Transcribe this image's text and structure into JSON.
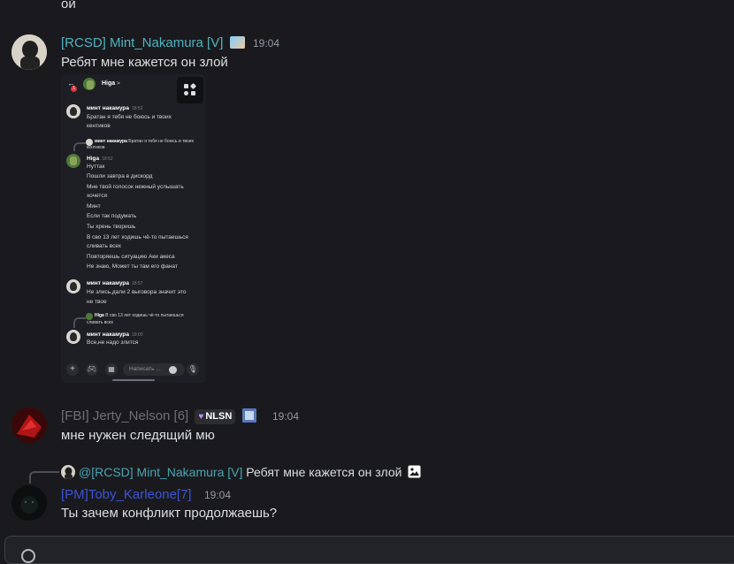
{
  "top_fragment": "ой",
  "messages": [
    {
      "username": "[RCSD] Mint_Nakamura [V]",
      "username_color": "#4fb3c0",
      "time": "19:04",
      "text": "Ребят мне кажется он злой",
      "attachment": {
        "header_name": "Higa",
        "header_chevron": ">",
        "badge_count": "1",
        "chat": {
          "m1_name": "минт накамура",
          "m1_time": "18:52",
          "m1_lines": [
            "Братан я тебя не боюсь и твоих",
            "кентиков"
          ],
          "reply1_name": "минт накамура",
          "reply1_text": "Братан я тебя не боюсь и твоих",
          "reply1_text2": "кентиков",
          "m2_name": "Higa",
          "m2_time": "18:52",
          "m2_lines": [
            "Нуттак",
            "Пошли завтра в дискорд",
            "Мне твой голосок нежный услышать",
            "хочется",
            "Минт",
            "Если так подумать",
            "Ты хрень творишь",
            "В сво 13 лет ходишь чё-то пытаешься",
            "сливать всех",
            "Повторяешь ситуацию Аки акеса",
            "Не знаю, Может ты там его фанат"
          ],
          "m3_name": "минт накамура",
          "m3_time": "18:57",
          "m3_lines": [
            "Не злись,дали 2 выговора значит это",
            "не твое"
          ],
          "reply2_name": "Higa",
          "reply2_text": "В сво 13 лет ходишь чё-то пытаешься",
          "reply2_text2": "сливать всех",
          "m4_name": "минт накамура",
          "m4_time": "19:00",
          "m4_lines": [
            "Все,не надо злится"
          ],
          "input_placeholder": "Написать ..."
        }
      }
    },
    {
      "username": "[FBI] Jerty_Nelson [6]",
      "username_color": "#6d6f78",
      "badge_text": "NLSN",
      "time": "19:04",
      "text": "мне нужен следящий мю"
    },
    {
      "reply_username": "@[RCSD] Mint_Nakamura [V]",
      "reply_text": "Ребят мне кажется он злой",
      "username": "[PM]Toby_Karleone[7]",
      "username_color": "#3b54d6",
      "time": "19:04",
      "text": "Ты зачем конфликт продолжаешь?"
    }
  ]
}
